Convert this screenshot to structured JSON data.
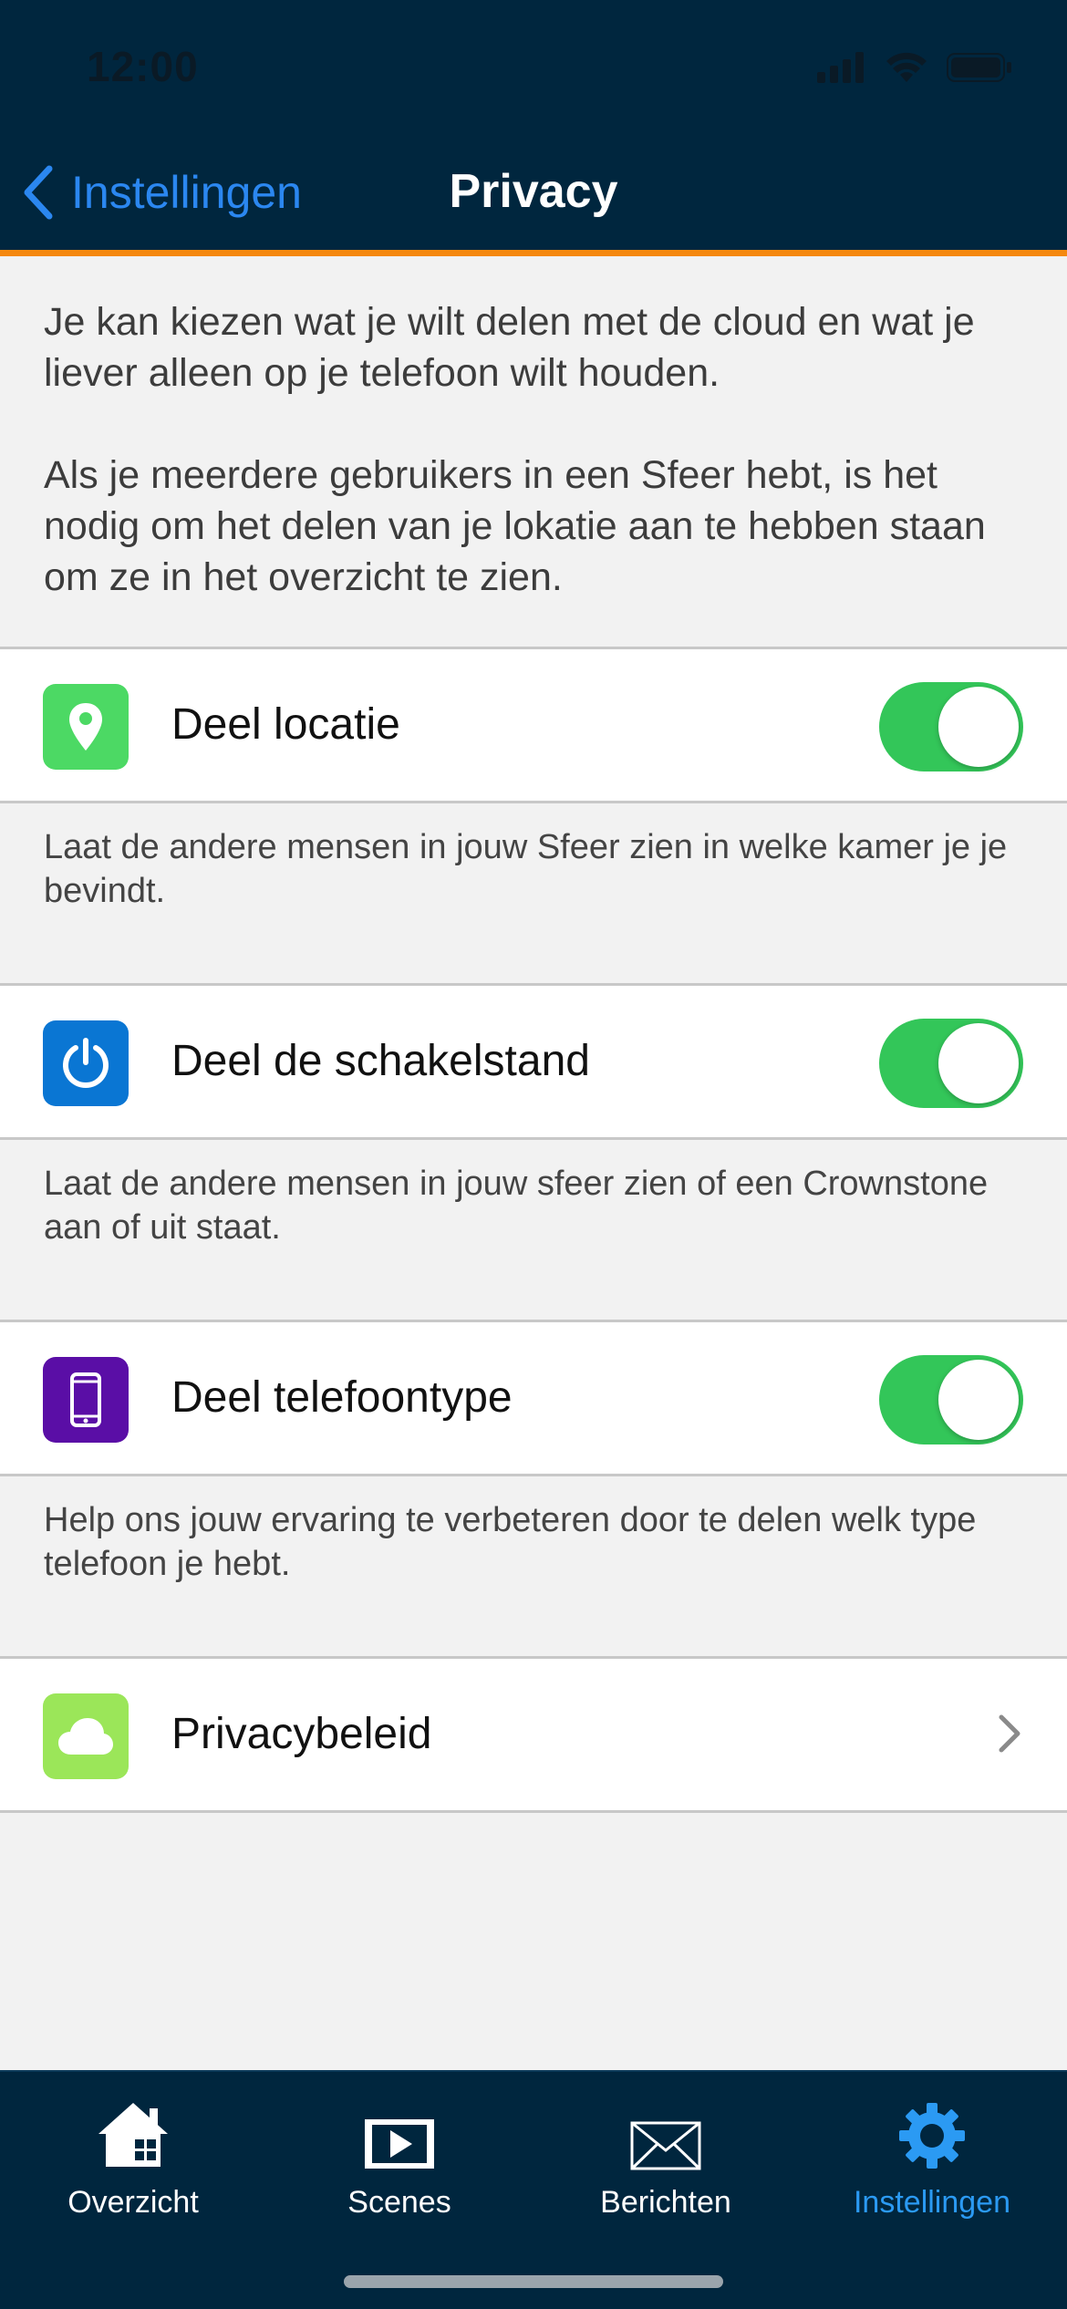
{
  "status": {
    "time": "12:00"
  },
  "nav": {
    "back_label": "Instellingen",
    "title": "Privacy"
  },
  "intro": {
    "p1": "Je kan kiezen wat je wilt delen met de cloud en wat je liever alleen op je telefoon wilt houden.",
    "p2": "Als je meerdere gebruikers in een Sfeer hebt, is het nodig om het delen van je lokatie aan te hebben staan om ze in het overzicht te zien."
  },
  "settings": [
    {
      "label": "Deel locatie",
      "icon": "location-pin-icon",
      "color": "#4cd964",
      "toggle": true,
      "description": "Laat de andere mensen in jouw Sfeer zien in welke kamer je je bevindt."
    },
    {
      "label": "Deel de schakelstand",
      "icon": "power-icon",
      "color": "#0a76d3",
      "toggle": true,
      "description": "Laat de andere mensen in jouw sfeer zien of een Crownstone aan of uit staat."
    },
    {
      "label": "Deel telefoontype",
      "icon": "phone-icon",
      "color": "#5a0ea6",
      "toggle": true,
      "description": "Help ons jouw ervaring te verbeteren door te delen welk type telefoon je hebt."
    },
    {
      "label": "Privacybeleid",
      "icon": "cloud-icon",
      "color": "#9be659",
      "toggle": null
    }
  ],
  "colors": {
    "header": "#00263e",
    "accent": "#f5880f",
    "toggle_on": "#33c659",
    "tab_active": "#2b9af3"
  },
  "tabs": [
    {
      "label": "Overzicht",
      "icon": "home-icon"
    },
    {
      "label": "Scenes",
      "icon": "scenes-icon"
    },
    {
      "label": "Berichten",
      "icon": "envelope-icon"
    },
    {
      "label": "Instellingen",
      "icon": "gear-icon",
      "active": true
    }
  ]
}
